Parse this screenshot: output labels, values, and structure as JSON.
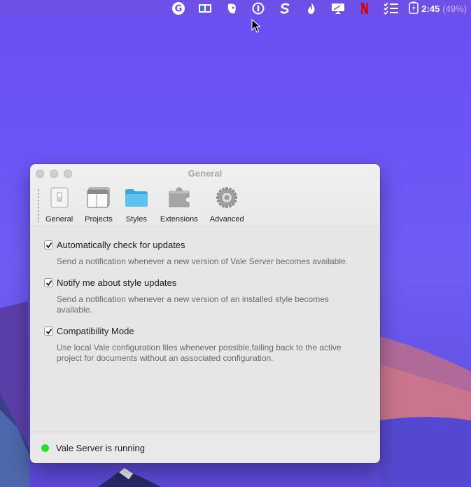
{
  "menubar": {
    "icons": [
      "grammarly-icon",
      "display-icon",
      "evernote-icon",
      "1password-icon",
      "scrivener-icon",
      "fire-icon",
      "screen-share-icon",
      "netflix-icon",
      "checklist-icon"
    ],
    "battery_icon": "battery-icon",
    "time": "2:45",
    "battery_pct": "(49%)"
  },
  "window": {
    "title": "General",
    "toolbar": [
      {
        "label": "General",
        "icon": "switch-icon"
      },
      {
        "label": "Projects",
        "icon": "window-icon"
      },
      {
        "label": "Styles",
        "icon": "folder-icon"
      },
      {
        "label": "Extensions",
        "icon": "puzzle-icon"
      },
      {
        "label": "Advanced",
        "icon": "gear-icon"
      }
    ],
    "options": [
      {
        "label": "Automatically check for updates",
        "checked": true,
        "desc": "Send a notification whenever a new version of Vale Server becomes available."
      },
      {
        "label": "Notify me about style updates",
        "checked": true,
        "desc": "Send a notification whenever a new version of an installed style becomes available."
      },
      {
        "label": "Compatibility Mode",
        "checked": true,
        "desc": "Use local Vale configuration files whenever possible,falling back to the active project for documents without an associated configuration."
      }
    ],
    "status": {
      "text": "Vale Server is running",
      "color": "#2adf2a"
    }
  },
  "colors": {
    "desktop": "#6b55f6",
    "window_bg": "#e6e6e6"
  }
}
